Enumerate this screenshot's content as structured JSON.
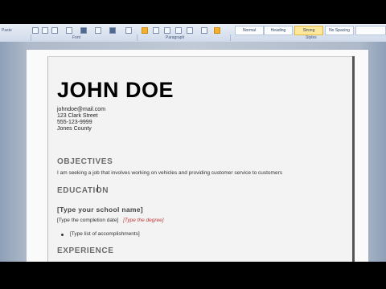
{
  "ribbon": {
    "clipboard_label": "Paste",
    "groups": {
      "font": "Font",
      "paragraph": "Paragraph",
      "styles": "Styles"
    },
    "style_chips": [
      "Normal",
      "Heading",
      "Strong",
      "No Spacing"
    ]
  },
  "resume": {
    "name": "JOHN DOE",
    "contact": {
      "email": "johndoe@mail.com",
      "street": "123 Clark Street",
      "phone": "555-123-9999",
      "county": "Jones County"
    },
    "objectives_heading": "OBJECTIVES",
    "objective_text": "I am seeking a job that involves working on vehicles and providing customer service to customers",
    "education_heading": "EDUCATION",
    "school_placeholder": "[Type your school name]",
    "completion_placeholder": "[Type the completion date]",
    "degree_placeholder": "[Type the degree]",
    "accomplishments_placeholder": "[Type list of accomplishments]",
    "experience_heading": "EXPERIENCE"
  },
  "colors": {
    "heading_gray": "#6b6b6b",
    "degree_red": "#c03a3a",
    "selected_style": "#fde79a"
  }
}
